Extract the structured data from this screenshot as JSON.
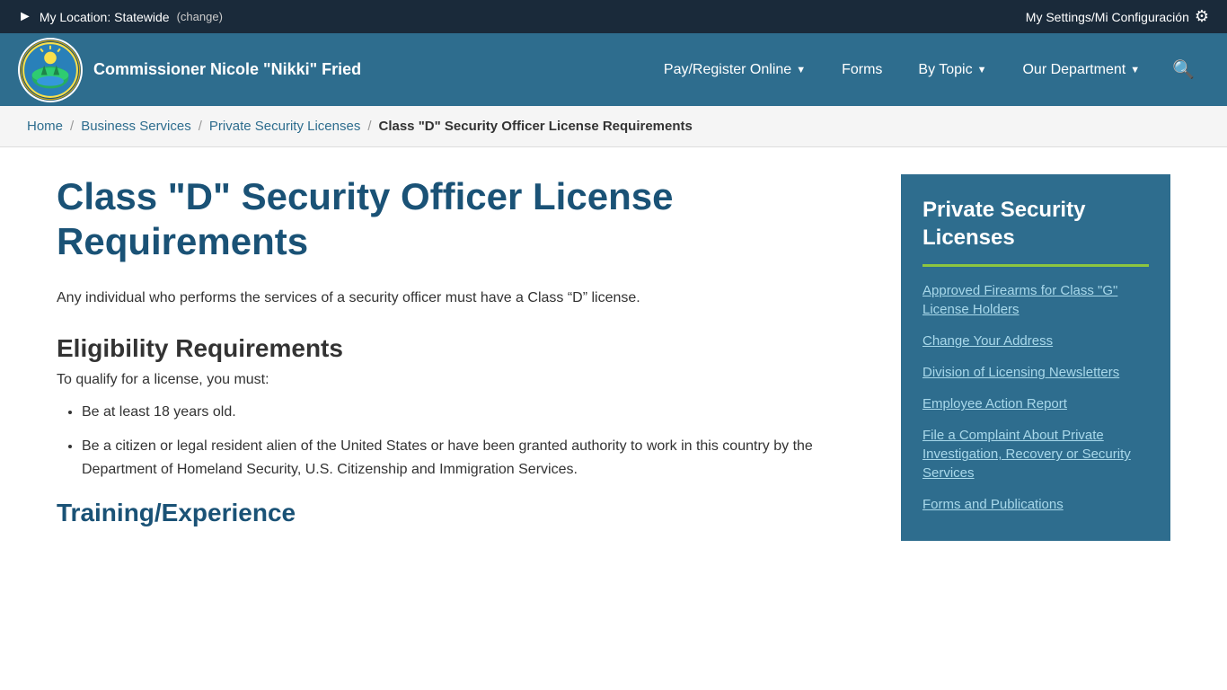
{
  "topbar": {
    "location_prefix": "My Location: Statewide",
    "change_label": "(change)",
    "settings_label": "My Settings/Mi Configuración"
  },
  "header": {
    "commissioner": "Commissioner Nicole \"Nikki\" Fried",
    "nav": [
      {
        "label": "Pay/Register Online",
        "has_arrow": true
      },
      {
        "label": "Forms",
        "has_arrow": false
      },
      {
        "label": "By Topic",
        "has_arrow": true
      },
      {
        "label": "Our Department",
        "has_arrow": true
      }
    ]
  },
  "breadcrumb": {
    "items": [
      {
        "label": "Home",
        "link": true
      },
      {
        "label": "Business Services",
        "link": true
      },
      {
        "label": "Private Security Licenses",
        "link": true
      },
      {
        "label": "Class \"D\" Security Officer License Requirements",
        "link": false
      }
    ]
  },
  "main": {
    "page_title": "Class \"D\" Security Officer License Requirements",
    "intro": "Any individual who performs the services of a security officer must have a Class “D” license.",
    "eligibility_heading": "Eligibility Requirements",
    "eligibility_subtext": "To qualify for a license, you must:",
    "bullets": [
      "Be at least 18 years old.",
      "Be a citizen or legal resident alien of the United States or have been granted authority to work in this country by the Department of Homeland Security, U.S. Citizenship and Immigration Services."
    ],
    "training_heading": "Training/Experience"
  },
  "sidebar": {
    "title": "Private Security Licenses",
    "links": [
      "Approved Firearms for Class \"G\" License Holders",
      "Change Your Address",
      "Division of Licensing Newsletters",
      "Employee Action Report",
      "File a Complaint About Private Investigation, Recovery or Security Services",
      "Forms and Publications"
    ]
  }
}
